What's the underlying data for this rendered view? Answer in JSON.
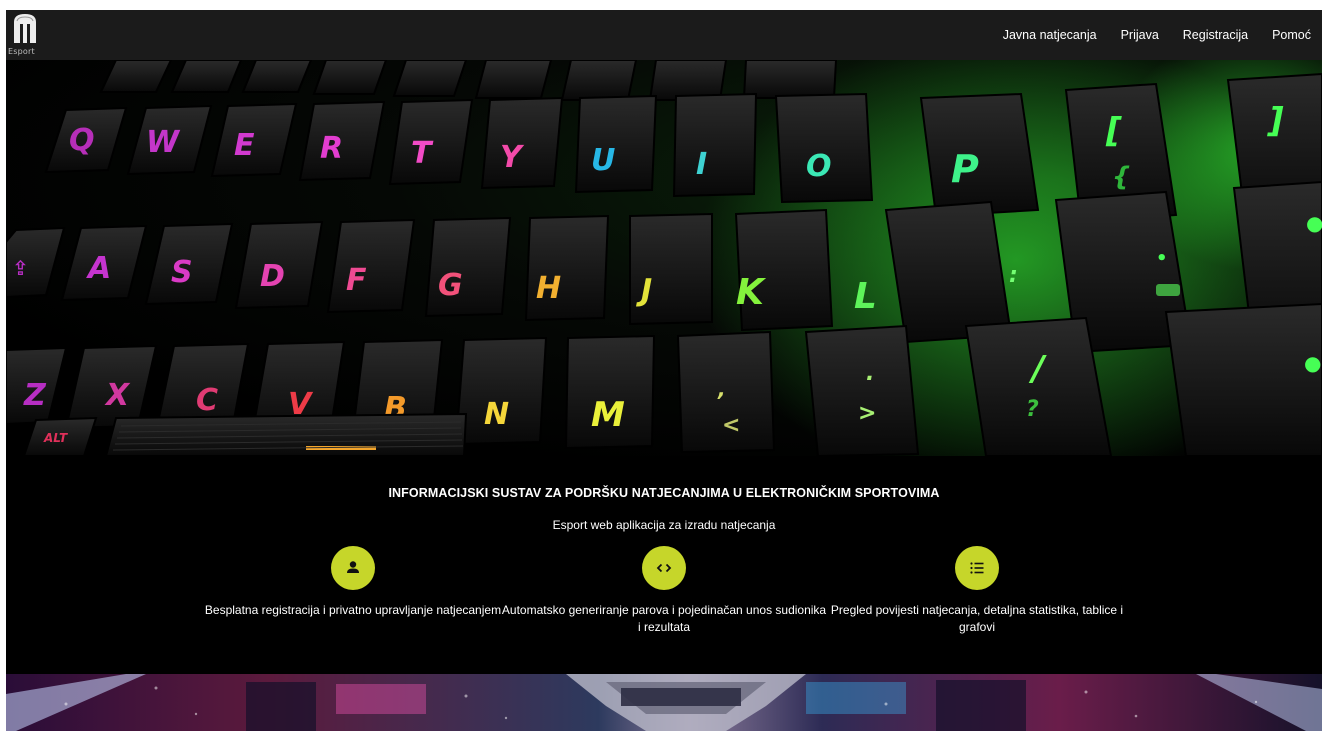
{
  "brand": {
    "logo_text": "Esport",
    "icon": "esport-logo-icon"
  },
  "nav": {
    "items": [
      {
        "label": "Javna natjecanja"
      },
      {
        "label": "Prijava"
      },
      {
        "label": "Registracija"
      },
      {
        "label": "Pomoć"
      }
    ]
  },
  "hero": {
    "image": "illuminated-keyboard-photo"
  },
  "info": {
    "title": "INFORMACIJSKI SUSTAV ZA PODRŠKU NATJECANJIMA U ELEKTRONIČKIM SPORTOVIMA",
    "subtitle": "Esport web aplikacija za izradu natjecanja",
    "accent_color": "#c6d62a",
    "features": [
      {
        "icon": "user-icon",
        "text": "Besplatna registracija i privatno upravljanje natjecanjem"
      },
      {
        "icon": "code-icon",
        "text": "Automatsko generiranje parova i pojedinačan unos sudionika i rezultata"
      },
      {
        "icon": "list-icon",
        "text": "Pregled povijesti natjecanja, detaljna statistika, tablice i grafovi"
      }
    ]
  },
  "footer_banner": {
    "image": "esports-arena-trophy-photo"
  }
}
